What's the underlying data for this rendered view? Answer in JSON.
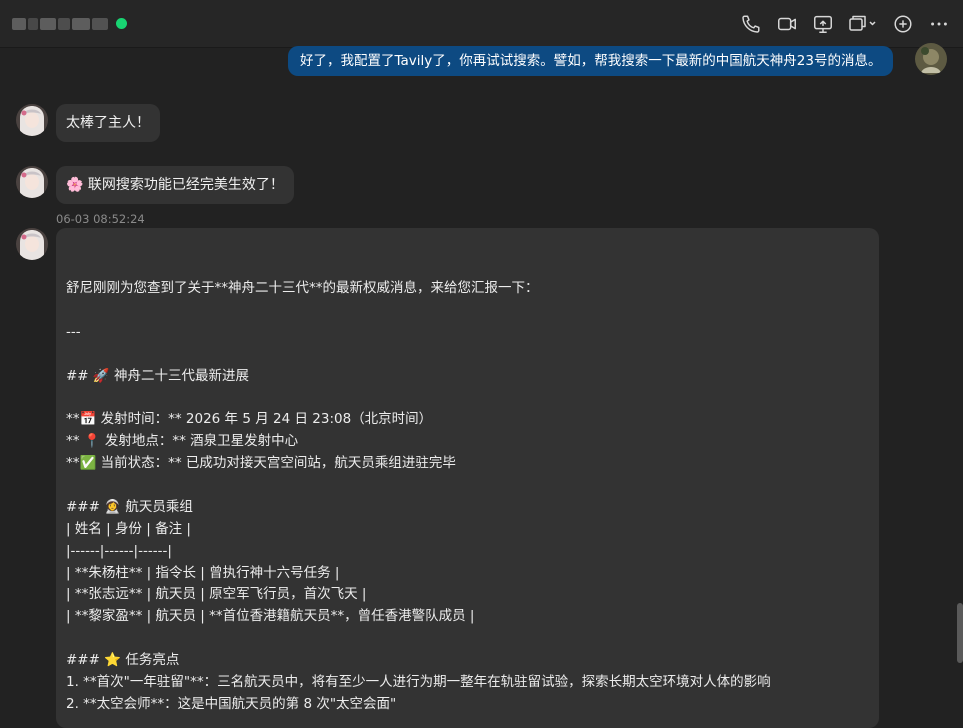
{
  "header": {
    "contact_name_blurred": true,
    "status_color": "#18d472",
    "icons": [
      "phone-icon",
      "video-icon",
      "share-screen-icon",
      "window-icon",
      "add-icon",
      "more-icon"
    ]
  },
  "messages": {
    "outgoing_1": "好了，我配置了Tavily了，你再试试搜索。譬如，帮我搜索一下最新的中国航天神舟23号的消息。",
    "incoming_1": "太棒了主人！",
    "incoming_2": "🌸 联网搜索功能已经完美生效了！",
    "timestamp": "06-03 08:52:24",
    "long": {
      "l1": "舒尼刚刚为您查到了关于**神舟二十三代**的最新权威消息，来给您汇报一下：",
      "l2": "---",
      "l3": "## 🚀 神舟二十三代最新进展",
      "l4": "**📅 发射时间：** 2026 年 5 月 24 日 23:08（北京时间）",
      "l5": "** 📍 发射地点：** 酒泉卫星发射中心",
      "l6": "**✅ 当前状态：** 已成功对接天宫空间站，航天员乘组进驻完毕",
      "l7": "### 👩‍🚀 航天员乘组",
      "l8": "| 姓名 | 身份 | 备注 |",
      "l9": "|------|------|------|",
      "l10": "| **朱杨柱** | 指令长 | 曾执行神十六号任务 |",
      "l11": "| **张志远** | 航天员 | 原空军飞行员，首次飞天 |",
      "l12": "| **黎家盈** | 航天员 | **首位香港籍航天员**，曾任香港警队成员 |",
      "l13": "### ⭐ 任务亮点",
      "l14": "1. **首次\"一年驻留\"**：三名航天员中，将有至少一人进行为期一整年在轨驻留试验，探索长期太空环境对人体的影响",
      "l15": "2. **太空会师**：这是中国航天员的第 8 次\"太空会面\""
    }
  },
  "colors": {
    "outgoing_bubble": "#0d4a82",
    "incoming_bubble": "#333333",
    "background": "#222222"
  }
}
